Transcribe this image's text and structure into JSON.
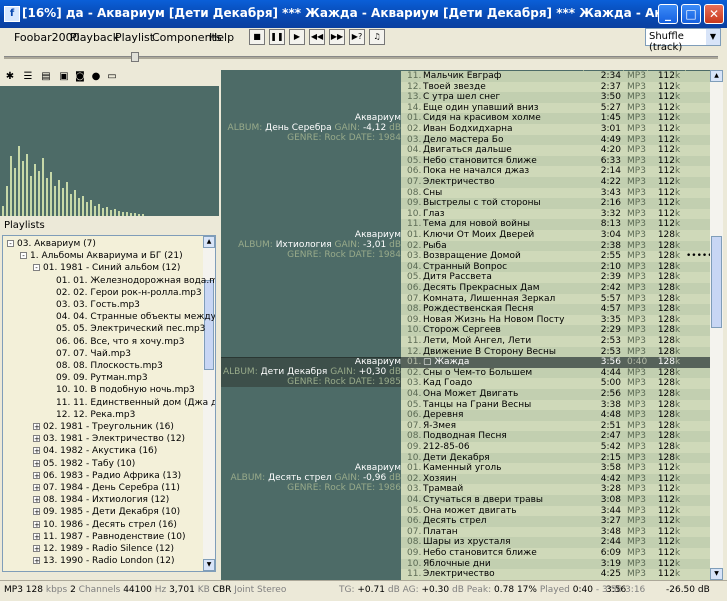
{
  "window": {
    "title": "[16%] да - Аквариум [Дети Декабря] *** Жажда - Аквариум [Дети Декабря] *** Жажда - Аквариум [Дети Декабря] *** Жаж",
    "minimize": "_",
    "maximize": "□",
    "close": "✕"
  },
  "menu": [
    "Foobar2000",
    "Playback",
    "Playlist",
    "Components",
    "Help"
  ],
  "playback_order": "Shuffle (track)",
  "seek_fraction": 0.18,
  "left": {
    "playlists_header": "Playlists",
    "icons": [
      "wand-icon",
      "list-icon",
      "equalizer-icon",
      "save-icon",
      "binoculars-icon",
      "record-icon",
      "console-icon"
    ],
    "tree": [
      {
        "indent": 0,
        "exp": "-",
        "text": "03. Аквариум (7)"
      },
      {
        "indent": 1,
        "exp": "-",
        "text": "1. Альбомы Аквариума и БГ (21)"
      },
      {
        "indent": 2,
        "exp": "-",
        "text": "01. 1981 - Синий альбом (12)"
      },
      {
        "indent": 3,
        "exp": "",
        "text": "01. 01. Железнодорожная вода.mp3"
      },
      {
        "indent": 3,
        "exp": "",
        "text": "02. 02. Герои рок-н-ролла.mp3"
      },
      {
        "indent": 3,
        "exp": "",
        "text": "03. 03. Гость.mp3"
      },
      {
        "indent": 3,
        "exp": "",
        "text": "04. 04. Странные объекты между свет"
      },
      {
        "indent": 3,
        "exp": "",
        "text": "05. 05. Электрический пес.mp3"
      },
      {
        "indent": 3,
        "exp": "",
        "text": "06. 06. Все, что я хочу.mp3"
      },
      {
        "indent": 3,
        "exp": "",
        "text": "07. 07. Чай.mp3"
      },
      {
        "indent": 3,
        "exp": "",
        "text": "08. 08. Плоскость.mp3"
      },
      {
        "indent": 3,
        "exp": "",
        "text": "09. 09. Рутман.mp3"
      },
      {
        "indent": 3,
        "exp": "",
        "text": "10. 10. В подобную ночь.mp3"
      },
      {
        "indent": 3,
        "exp": "",
        "text": "11. 11. Единственный дом (Джа даст к"
      },
      {
        "indent": 3,
        "exp": "",
        "text": "12. 12. Река.mp3"
      },
      {
        "indent": 2,
        "exp": "+",
        "text": "02. 1981 - Треугольник (16)"
      },
      {
        "indent": 2,
        "exp": "+",
        "text": "03. 1981 - Электричество (12)"
      },
      {
        "indent": 2,
        "exp": "+",
        "text": "04. 1982 - Акустика (16)"
      },
      {
        "indent": 2,
        "exp": "+",
        "text": "05. 1982 - Табу (10)"
      },
      {
        "indent": 2,
        "exp": "+",
        "text": "06. 1983 - Радио Африка (13)"
      },
      {
        "indent": 2,
        "exp": "+",
        "text": "07. 1984 - День Серебра (11)"
      },
      {
        "indent": 2,
        "exp": "+",
        "text": "08. 1984 - Ихтиология (12)"
      },
      {
        "indent": 2,
        "exp": "+",
        "text": "09. 1985 - Дети Декабря (10)"
      },
      {
        "indent": 2,
        "exp": "+",
        "text": "10. 1986 - Десять стрел (16)"
      },
      {
        "indent": 2,
        "exp": "+",
        "text": "11. 1987 - Равноденствие (10)"
      },
      {
        "indent": 2,
        "exp": "+",
        "text": "12. 1989 - Radio Silence (12)"
      },
      {
        "indent": 2,
        "exp": "+",
        "text": "13. 1990 - Radio London (12)"
      }
    ]
  },
  "groups": [
    {
      "artist": "Аквариум",
      "album_label": "ALBUM:",
      "album": "День Серебра",
      "gain_label": "GAIN:",
      "gain": "-4,12",
      "gain_unit": "dB",
      "genre_label": "GENRE:",
      "genre": "Rock",
      "date_label": "DATE:",
      "date": "1984"
    },
    {
      "artist": "Аквариум",
      "album_label": "ALBUM:",
      "album": "Ихтиология",
      "gain_label": "GAIN:",
      "gain": "-3,01",
      "gain_unit": "dB",
      "genre_label": "GENRE:",
      "genre": "Rock",
      "date_label": "DATE:",
      "date": "1984"
    },
    {
      "artist": "Аквариум",
      "album_label": "ALBUM:",
      "album": "Дети Декабря",
      "gain_label": "GAIN:",
      "gain": "+0,30",
      "gain_unit": "dB",
      "genre_label": "GENRE:",
      "genre": "Rock",
      "date_label": "DATE:",
      "date": "1985"
    },
    {
      "artist": "Аквариум",
      "album_label": "ALBUM:",
      "album": "Десять стрел",
      "gain_label": "GAIN:",
      "gain": "-0,96",
      "gain_unit": "dB",
      "genre_label": "GENRE:",
      "genre": "Rock",
      "date_label": "DATE:",
      "date": "1986"
    }
  ],
  "tracks": [
    {
      "num": "11.",
      "title": "Мальчик Евграф",
      "dur": "2:34",
      "codec": "MP3",
      "bitrate": "112",
      "extra": ""
    },
    {
      "num": "12.",
      "title": "Твоей звезде",
      "dur": "2:37",
      "codec": "MP3",
      "bitrate": "112",
      "extra": ""
    },
    {
      "num": "13.",
      "title": "С утра шел снег",
      "dur": "3:50",
      "codec": "MP3",
      "bitrate": "112",
      "extra": ""
    },
    {
      "num": "14.",
      "title": "Еще один упавший вниз",
      "dur": "5:27",
      "codec": "MP3",
      "bitrate": "112",
      "extra": ""
    },
    {
      "num": "01.",
      "title": "Сидя на красивом холме",
      "dur": "1:45",
      "codec": "MP3",
      "bitrate": "112",
      "extra": ""
    },
    {
      "num": "02.",
      "title": "Иван Бодхидхарна",
      "dur": "3:01",
      "codec": "MP3",
      "bitrate": "112",
      "extra": ""
    },
    {
      "num": "03.",
      "title": "Дело мастера Бо",
      "dur": "4:49",
      "codec": "MP3",
      "bitrate": "112",
      "extra": ""
    },
    {
      "num": "04.",
      "title": "Двигаться дальше",
      "dur": "4:20",
      "codec": "MP3",
      "bitrate": "112",
      "extra": ""
    },
    {
      "num": "05.",
      "title": "Небо становится ближе",
      "dur": "6:33",
      "codec": "MP3",
      "bitrate": "112",
      "extra": ""
    },
    {
      "num": "06.",
      "title": "Пока не начался джаз",
      "dur": "2:14",
      "codec": "MP3",
      "bitrate": "112",
      "extra": ""
    },
    {
      "num": "07.",
      "title": "Электричество",
      "dur": "4:22",
      "codec": "MP3",
      "bitrate": "112",
      "extra": ""
    },
    {
      "num": "08.",
      "title": "Сны",
      "dur": "3:43",
      "codec": "MP3",
      "bitrate": "112",
      "extra": ""
    },
    {
      "num": "09.",
      "title": "Выстрелы с той стороны",
      "dur": "2:16",
      "codec": "MP3",
      "bitrate": "112",
      "extra": ""
    },
    {
      "num": "10.",
      "title": "Глаз",
      "dur": "3:32",
      "codec": "MP3",
      "bitrate": "112",
      "extra": ""
    },
    {
      "num": "11.",
      "title": "Тема для новой войны",
      "dur": "8:13",
      "codec": "MP3",
      "bitrate": "112",
      "extra": ""
    },
    {
      "num": "01.",
      "title": "Ключи От Моих Дверей",
      "dur": "3:04",
      "codec": "MP3",
      "bitrate": "128",
      "extra": ""
    },
    {
      "num": "02.",
      "title": "Рыба",
      "dur": "2:38",
      "codec": "MP3",
      "bitrate": "128",
      "extra": ""
    },
    {
      "num": "03.",
      "title": "Возвращение Домой",
      "dur": "2:55",
      "codec": "MP3",
      "bitrate": "128",
      "extra": "•••••"
    },
    {
      "num": "04.",
      "title": "Странный Вопрос",
      "dur": "2:10",
      "codec": "MP3",
      "bitrate": "128",
      "extra": ""
    },
    {
      "num": "05.",
      "title": "Дитя Рассвета",
      "dur": "2:39",
      "codec": "MP3",
      "bitrate": "128",
      "extra": ""
    },
    {
      "num": "06.",
      "title": "Десять Прекрасных Дам",
      "dur": "2:42",
      "codec": "MP3",
      "bitrate": "128",
      "extra": ""
    },
    {
      "num": "07.",
      "title": "Комната, Лишенная Зеркал",
      "dur": "5:57",
      "codec": "MP3",
      "bitrate": "128",
      "extra": ""
    },
    {
      "num": "08.",
      "title": "Рождественская Песня",
      "dur": "4:57",
      "codec": "MP3",
      "bitrate": "128",
      "extra": ""
    },
    {
      "num": "09.",
      "title": "Новая Жизнь На Новом Посту",
      "dur": "3:35",
      "codec": "MP3",
      "bitrate": "128",
      "extra": ""
    },
    {
      "num": "10.",
      "title": "Сторож Сергеев",
      "dur": "2:29",
      "codec": "MP3",
      "bitrate": "128",
      "extra": ""
    },
    {
      "num": "11.",
      "title": "Лети, Мой Ангел, Лети",
      "dur": "2:53",
      "codec": "MP3",
      "bitrate": "128",
      "extra": ""
    },
    {
      "num": "12.",
      "title": "Движение В Сторону Весны",
      "dur": "2:53",
      "codec": "MP3",
      "bitrate": "128",
      "extra": ""
    },
    {
      "num": "01.",
      "title": "▢ Жажда",
      "dur": "3:56",
      "codec": "0:40",
      "bitrate": "128",
      "extra": "",
      "current": true
    },
    {
      "num": "02.",
      "title": "Сны о Чем-то Большем",
      "dur": "4:44",
      "codec": "MP3",
      "bitrate": "128",
      "extra": ""
    },
    {
      "num": "03.",
      "title": "Кад Гоадо",
      "dur": "5:00",
      "codec": "MP3",
      "bitrate": "128",
      "extra": ""
    },
    {
      "num": "04.",
      "title": "Она Может Двигать",
      "dur": "2:56",
      "codec": "MP3",
      "bitrate": "128",
      "extra": ""
    },
    {
      "num": "05.",
      "title": "Танцы на Грани Весны",
      "dur": "3:38",
      "codec": "MP3",
      "bitrate": "128",
      "extra": ""
    },
    {
      "num": "06.",
      "title": "Деревня",
      "dur": "4:48",
      "codec": "MP3",
      "bitrate": "128",
      "extra": ""
    },
    {
      "num": "07.",
      "title": "Я-Змея",
      "dur": "2:51",
      "codec": "MP3",
      "bitrate": "128",
      "extra": ""
    },
    {
      "num": "08.",
      "title": "Подводная Песня",
      "dur": "2:47",
      "codec": "MP3",
      "bitrate": "128",
      "extra": ""
    },
    {
      "num": "09.",
      "title": "212-85-06",
      "dur": "5:42",
      "codec": "MP3",
      "bitrate": "128",
      "extra": ""
    },
    {
      "num": "10.",
      "title": "Дети Декабря",
      "dur": "2:15",
      "codec": "MP3",
      "bitrate": "128",
      "extra": ""
    },
    {
      "num": "01.",
      "title": "Каменный уголь",
      "dur": "3:58",
      "codec": "MP3",
      "bitrate": "112",
      "extra": ""
    },
    {
      "num": "02.",
      "title": "Хозяин",
      "dur": "4:42",
      "codec": "MP3",
      "bitrate": "112",
      "extra": ""
    },
    {
      "num": "03.",
      "title": "Трамвай",
      "dur": "3:28",
      "codec": "MP3",
      "bitrate": "112",
      "extra": ""
    },
    {
      "num": "04.",
      "title": "Стучаться в двери травы",
      "dur": "3:08",
      "codec": "MP3",
      "bitrate": "112",
      "extra": ""
    },
    {
      "num": "05.",
      "title": "Она может двигать",
      "dur": "3:44",
      "codec": "MP3",
      "bitrate": "112",
      "extra": ""
    },
    {
      "num": "06.",
      "title": "Десять стрел",
      "dur": "3:27",
      "codec": "MP3",
      "bitrate": "112",
      "extra": ""
    },
    {
      "num": "07.",
      "title": "Платан",
      "dur": "3:48",
      "codec": "MP3",
      "bitrate": "112",
      "extra": ""
    },
    {
      "num": "08.",
      "title": "Шары из хрусталя",
      "dur": "2:44",
      "codec": "MP3",
      "bitrate": "112",
      "extra": ""
    },
    {
      "num": "09.",
      "title": "Небо становится ближе",
      "dur": "6:09",
      "codec": "MP3",
      "bitrate": "112",
      "extra": ""
    },
    {
      "num": "10.",
      "title": "Яблочные дни",
      "dur": "3:19",
      "codec": "MP3",
      "bitrate": "112",
      "extra": ""
    },
    {
      "num": "11.",
      "title": "Электричество",
      "dur": "4:25",
      "codec": "MP3",
      "bitrate": "112",
      "extra": ""
    }
  ],
  "bitrate_unit": "k",
  "status": {
    "codec": "MP3",
    "kbps": "128",
    "kbps_unit": "kbps",
    "channels": "2",
    "channels_unit": "Channels",
    "rate": "44100",
    "rate_unit": "Hz",
    "size": "3,701",
    "size_unit": "KB",
    "mode": "CBR",
    "stereo": "Joint Stereo",
    "tg_label": "TG:",
    "tg": "+0.71",
    "tg_unit": "dB",
    "ag_label": "AG:",
    "ag": "+0.30",
    "ag_unit": "dB",
    "peak_label": "Peak:",
    "peak": "0.78",
    "played_pct": "17%",
    "played_label": "Played",
    "played_time": "0:40",
    "sep": "-",
    "total": "3:56",
    "remaining": "3:16",
    "length": "3:56",
    "volume": "-26.50 dB"
  }
}
